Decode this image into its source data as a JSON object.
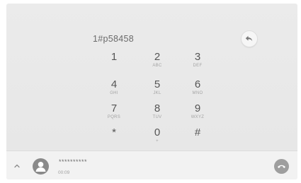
{
  "dialer": {
    "display_number": "1#p58458",
    "keys": [
      {
        "digit": "1",
        "letters": ""
      },
      {
        "digit": "2",
        "letters": "ABC"
      },
      {
        "digit": "3",
        "letters": "DEF"
      },
      {
        "digit": "4",
        "letters": "GHI"
      },
      {
        "digit": "5",
        "letters": "JKL"
      },
      {
        "digit": "6",
        "letters": "MNO"
      },
      {
        "digit": "7",
        "letters": "PQRS"
      },
      {
        "digit": "8",
        "letters": "TUV"
      },
      {
        "digit": "9",
        "letters": "WXYZ"
      },
      {
        "digit": "*",
        "letters": ""
      },
      {
        "digit": "0",
        "letters": "+"
      },
      {
        "digit": "#",
        "letters": ""
      }
    ]
  },
  "call": {
    "number": "**********",
    "duration": "00:09"
  },
  "icons": {
    "backspace": "backspace-icon",
    "expand": "chevron-up-icon",
    "avatar": "person-icon",
    "end_call": "phone-hangup-icon"
  },
  "colors": {
    "screen_bg": "#e8e8e8",
    "call_bar_bg": "#f2f2f2",
    "end_call_button": "#9e9e9e",
    "avatar_bg": "#8a8a8a"
  }
}
